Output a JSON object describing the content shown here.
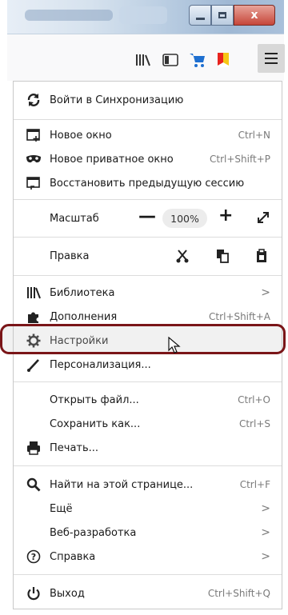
{
  "window": {
    "controls": {
      "minimize_icon": "minimize-icon",
      "maximize_icon": "maximize-icon",
      "close_label": "x"
    }
  },
  "toolbar": {
    "icons": [
      "library-icon",
      "sidebar-icon",
      "cart-icon",
      "bookmark-flag-icon",
      "hamburger-menu-icon"
    ]
  },
  "menu": {
    "sync": {
      "label": "Войти в Синхронизацию",
      "icon": "sync-icon"
    },
    "new_window": {
      "label": "Новое окно",
      "shortcut": "Ctrl+N",
      "icon": "new-window-icon"
    },
    "private_window": {
      "label": "Новое приватное окно",
      "shortcut": "Ctrl+Shift+P",
      "icon": "mask-icon"
    },
    "restore_session": {
      "label": "Восстановить предыдущую сессию",
      "icon": "restore-session-icon"
    },
    "zoom": {
      "label": "Масштаб",
      "minus": "—",
      "value": "100%",
      "plus": "+"
    },
    "edit": {
      "label": "Правка",
      "icons": [
        "cut-icon",
        "copy-icon",
        "paste-icon"
      ]
    },
    "library": {
      "label": "Библиотека",
      "arrow": ">",
      "icon": "library-icon"
    },
    "addons": {
      "label": "Дополнения",
      "shortcut": "Ctrl+Shift+A",
      "icon": "puzzle-icon"
    },
    "settings": {
      "label": "Настройки",
      "icon": "gear-icon"
    },
    "customize": {
      "label": "Персонализация...",
      "icon": "brush-icon"
    },
    "open_file": {
      "label": "Открыть файл...",
      "shortcut": "Ctrl+O"
    },
    "save_as": {
      "label": "Сохранить как...",
      "shortcut": "Ctrl+S"
    },
    "print": {
      "label": "Печать...",
      "icon": "printer-icon"
    },
    "find": {
      "label": "Найти на этой странице...",
      "shortcut": "Ctrl+F",
      "icon": "search-icon"
    },
    "more": {
      "label": "Ещё",
      "arrow": ">"
    },
    "webdev": {
      "label": "Веб-разработка",
      "arrow": ">"
    },
    "help": {
      "label": "Справка",
      "arrow": ">",
      "icon": "help-icon"
    },
    "exit": {
      "label": "Выход",
      "shortcut": "Ctrl+Shift+Q",
      "icon": "power-icon"
    }
  },
  "colors": {
    "highlight_border": "#7a1518",
    "menu_button_bg": "#d8d8d8",
    "shortcut_text": "#7a7a7a",
    "close_button": "#c6463a"
  }
}
